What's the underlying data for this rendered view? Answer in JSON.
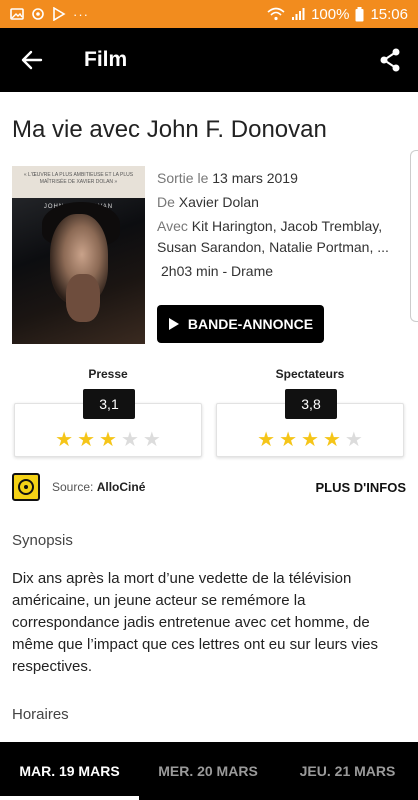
{
  "status_bar": {
    "battery": "100%",
    "time": "15:06",
    "dots": "···"
  },
  "app_bar": {
    "title": "Film"
  },
  "movie": {
    "title": "Ma vie avec John F. Donovan",
    "release_label": "Sortie le",
    "release_date": "13 mars 2019",
    "director_label": "De",
    "director": "Xavier Dolan",
    "cast_label": "Avec",
    "cast": "Kit Harington, Jacob Tremblay, Susan Sarandon, Natalie Portman, ...",
    "duration_genre": "2h03 min - Drame",
    "trailer_label": "BANDE-ANNONCE",
    "poster_text": "« L'ŒUVRE LA PLUS AMBITIEUSE ET LA PLUS MAÎTRISÉE DE XAVIER DOLAN »",
    "poster_title": "JOHN F. DONOVAN"
  },
  "ratings": {
    "press": {
      "label": "Presse",
      "score": "3,1",
      "stars": 3
    },
    "audience": {
      "label": "Spectateurs",
      "score": "3,8",
      "stars": 4
    }
  },
  "source": {
    "prefix": "Source:",
    "name": "AlloCiné",
    "more": "PLUS D'INFOS"
  },
  "synopsis": {
    "title": "Synopsis",
    "text": "Dix ans après la mort d’une vedette de la télévision américaine, un jeune acteur se remémore la correspondance jadis entretenue avec cet homme, de même que l’impact que ces lettres ont eu sur leurs vies respectives."
  },
  "showtimes": {
    "title": "Horaires",
    "tabs": [
      {
        "label": "MAR. 19 MARS",
        "active": true
      },
      {
        "label": "MER. 20 MARS",
        "active": false
      },
      {
        "label": "JEU. 21 MARS",
        "active": false
      }
    ]
  },
  "colors": {
    "status_bar": "#f28c1e",
    "app_bar": "#000000",
    "star_active": "#f5c518",
    "star_inactive": "#dcdcdc"
  }
}
